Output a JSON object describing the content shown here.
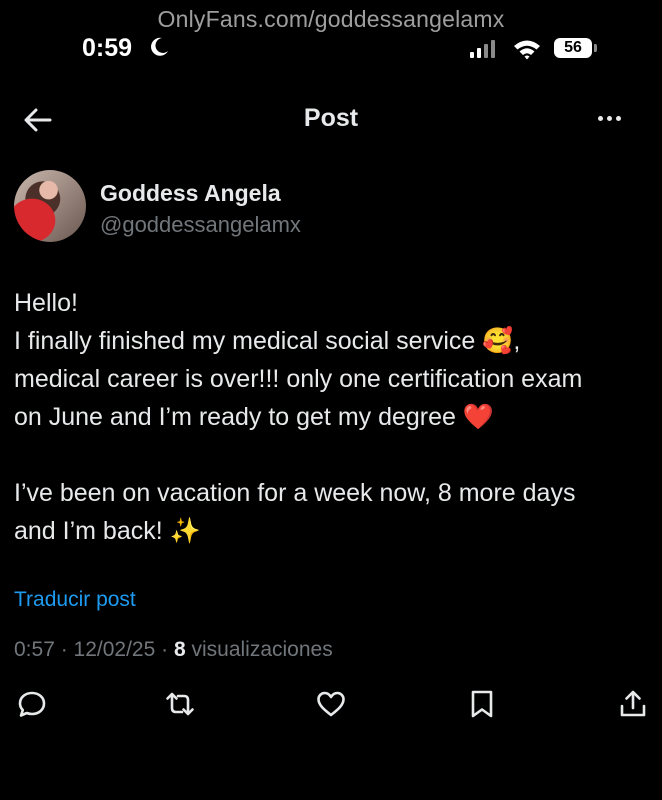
{
  "watermark": "OnlyFans.com/goddessangelamx",
  "status": {
    "time": "0:59",
    "battery": "56",
    "signal_bars": 2,
    "signal_total": 4
  },
  "header": {
    "title": "Post",
    "back_icon": "arrow-left-icon",
    "more_icon": "more-horizontal-icon"
  },
  "post": {
    "author_name": "Goddess Angela",
    "author_handle": "@goddessangelamx",
    "text": {
      "line1": "Hello!",
      "line2": "I finally finished my medical social service 🥰,",
      "line3": "medical career is over!!! only one certification exam",
      "line4": "on June and I’m ready to get my degree ❤️",
      "line5": "I’ve been on vacation for a week now, 8 more days",
      "line6": "and I’m back! ✨"
    },
    "translate": "Traducir post",
    "timestamp": "0:57 · 12/02/25 · ",
    "views_count": "8",
    "views_label": " visualizaciones"
  },
  "actions": [
    "reply-icon",
    "repost-icon",
    "like-icon",
    "bookmark-icon",
    "share-icon"
  ],
  "colors": {
    "background": "#000000",
    "text": "#e7e9ea",
    "muted": "#71767b",
    "link": "#1d9bf0"
  }
}
